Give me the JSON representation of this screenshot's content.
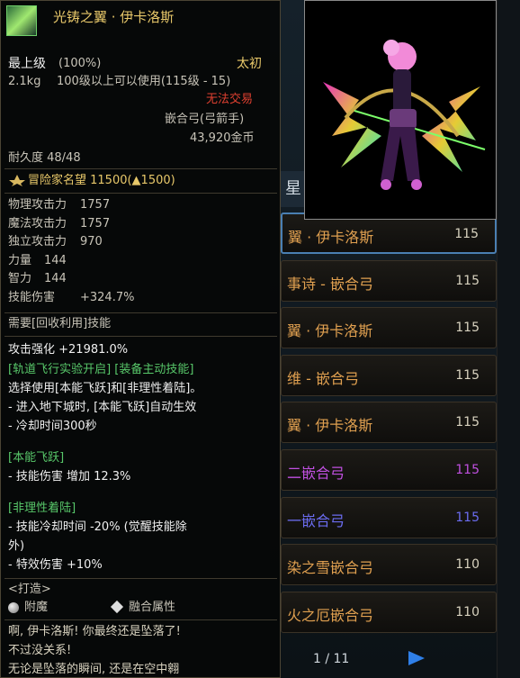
{
  "item": {
    "name": "光铸之翼 · 伊卡洛斯",
    "rarity": "最上级",
    "rarity_pct": "(100%)",
    "grade": "太初",
    "weight": "2.1kg",
    "req": "100级以上可以使用(115级 - 15)",
    "trade": "无法交易",
    "type": "嵌合弓(弓箭手)",
    "price": "43,920金币",
    "durability": "耐久度 48/48",
    "fame": "冒险家名望  11500(▲1500)",
    "stats": [
      {
        "label": "物理攻击力",
        "value": "1757"
      },
      {
        "label": "魔法攻击力",
        "value": "1757"
      },
      {
        "label": "独立攻击力",
        "value": "970"
      },
      {
        "label": "力量",
        "value": "144"
      },
      {
        "label": "智力",
        "value": "144"
      },
      {
        "label": "技能伤害",
        "value": "+324.7%"
      }
    ],
    "recycle": "需要[回收利用]技能",
    "attack_boost": "攻击强化 +21981.0%",
    "skill_line1": "[轨道飞行实验开启] [装备主动技能]",
    "skill_line2": "选择使用[本能飞跃]和[非理性着陆]。",
    "skill_line3": "- 进入地下城时, [本能飞跃]自动生效",
    "skill_line4": "- 冷却时间300秒",
    "leap_title": "[本能飞跃]",
    "leap_effect": "- 技能伤害 增加 12.3%",
    "landing_title": "[非理性着陆]",
    "landing_effect1": "- 技能冷却时间 -20% (觉醒技能除",
    "landing_effect2": "外)",
    "landing_effect3": "- 特效伤害 +10%",
    "forge_title": "<打造>",
    "enchant": "附魔",
    "fusion": "融合属性",
    "flavor1": "啊, 伊卡洛斯! 你最终还是坠落了!",
    "flavor2": "不过没关系!",
    "flavor3": "无论是坠落的瞬间, 还是在空中翱"
  },
  "list": {
    "rows": [
      {
        "name": "翼 · 伊卡洛斯",
        "level": "115",
        "color": "#e0a050"
      },
      {
        "name": "事诗 - 嵌合弓",
        "level": "115",
        "color": "#e0a050"
      },
      {
        "name": "翼 · 伊卡洛斯",
        "level": "115",
        "color": "#e0a050"
      },
      {
        "name": "维 - 嵌合弓",
        "level": "115",
        "color": "#e0a050"
      },
      {
        "name": "翼 · 伊卡洛斯",
        "level": "115",
        "color": "#e0a050"
      },
      {
        "name": "二嵌合弓",
        "level": "115",
        "color": "#c050e0"
      },
      {
        "name": "一嵌合弓",
        "level": "115",
        "color": "#6b6cf0"
      },
      {
        "name": "染之雪嵌合弓",
        "level": "110",
        "color": "#e0a050"
      },
      {
        "name": "火之厄嵌合弓",
        "level": "110",
        "color": "#e0a050"
      }
    ],
    "page": "1 / 11",
    "partial_header": "星"
  },
  "colors": {
    "gold": "#e8c86a",
    "green": "#58c86a",
    "red": "#e04030",
    "text": "#c8c4b8"
  }
}
